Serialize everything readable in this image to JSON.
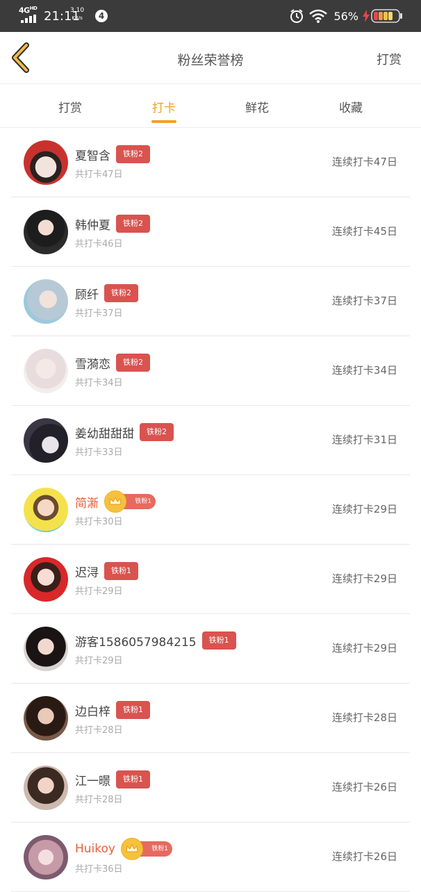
{
  "status_bar": {
    "network": "4G",
    "network_sup": "HD",
    "time": "21:11",
    "speed_value": "3.10",
    "speed_unit": "KB/s",
    "notification_count": "4",
    "battery_percent": "56%"
  },
  "header": {
    "title": "粉丝荣誉榜",
    "action_label": "打赏"
  },
  "tabs": [
    {
      "label": "打赏",
      "active": false
    },
    {
      "label": "打卡",
      "active": true
    },
    {
      "label": "鲜花",
      "active": false
    },
    {
      "label": "收藏",
      "active": false
    }
  ],
  "colors": {
    "accent": "#f2a027",
    "badge": "#d9534f",
    "vip_name": "#e85f3c",
    "status_bar": "#3b3b3b"
  },
  "fans": [
    {
      "name": "夏智含",
      "badge": "铁粉2",
      "crown": false,
      "total": "共打卡47日",
      "streak": "连续打卡47日"
    },
    {
      "name": "韩仲夏",
      "badge": "铁粉2",
      "crown": false,
      "total": "共打卡46日",
      "streak": "连续打卡45日"
    },
    {
      "name": "顾纤",
      "badge": "铁粉2",
      "crown": false,
      "total": "共打卡37日",
      "streak": "连续打卡37日"
    },
    {
      "name": "雪漪恋",
      "badge": "铁粉2",
      "crown": false,
      "total": "共打卡34日",
      "streak": "连续打卡34日"
    },
    {
      "name": "姜幼甜甜甜",
      "badge": "铁粉2",
      "crown": false,
      "total": "共打卡33日",
      "streak": "连续打卡31日"
    },
    {
      "name": "简澵",
      "badge": "铁粉1",
      "crown": true,
      "total": "共打卡30日",
      "streak": "连续打卡29日"
    },
    {
      "name": "迟浔",
      "badge": "铁粉1",
      "crown": false,
      "total": "共打卡29日",
      "streak": "连续打卡29日"
    },
    {
      "name": "游客1586057984215",
      "badge": "铁粉1",
      "crown": false,
      "total": "共打卡29日",
      "streak": "连续打卡29日"
    },
    {
      "name": "边白梓",
      "badge": "铁粉1",
      "crown": false,
      "total": "共打卡28日",
      "streak": "连续打卡28日"
    },
    {
      "name": "江一暻",
      "badge": "铁粉1",
      "crown": false,
      "total": "共打卡28日",
      "streak": "连续打卡26日"
    },
    {
      "name": "Huikoy",
      "badge": "铁粉1",
      "crown": true,
      "total": "共打卡36日",
      "streak": "连续打卡26日"
    }
  ]
}
